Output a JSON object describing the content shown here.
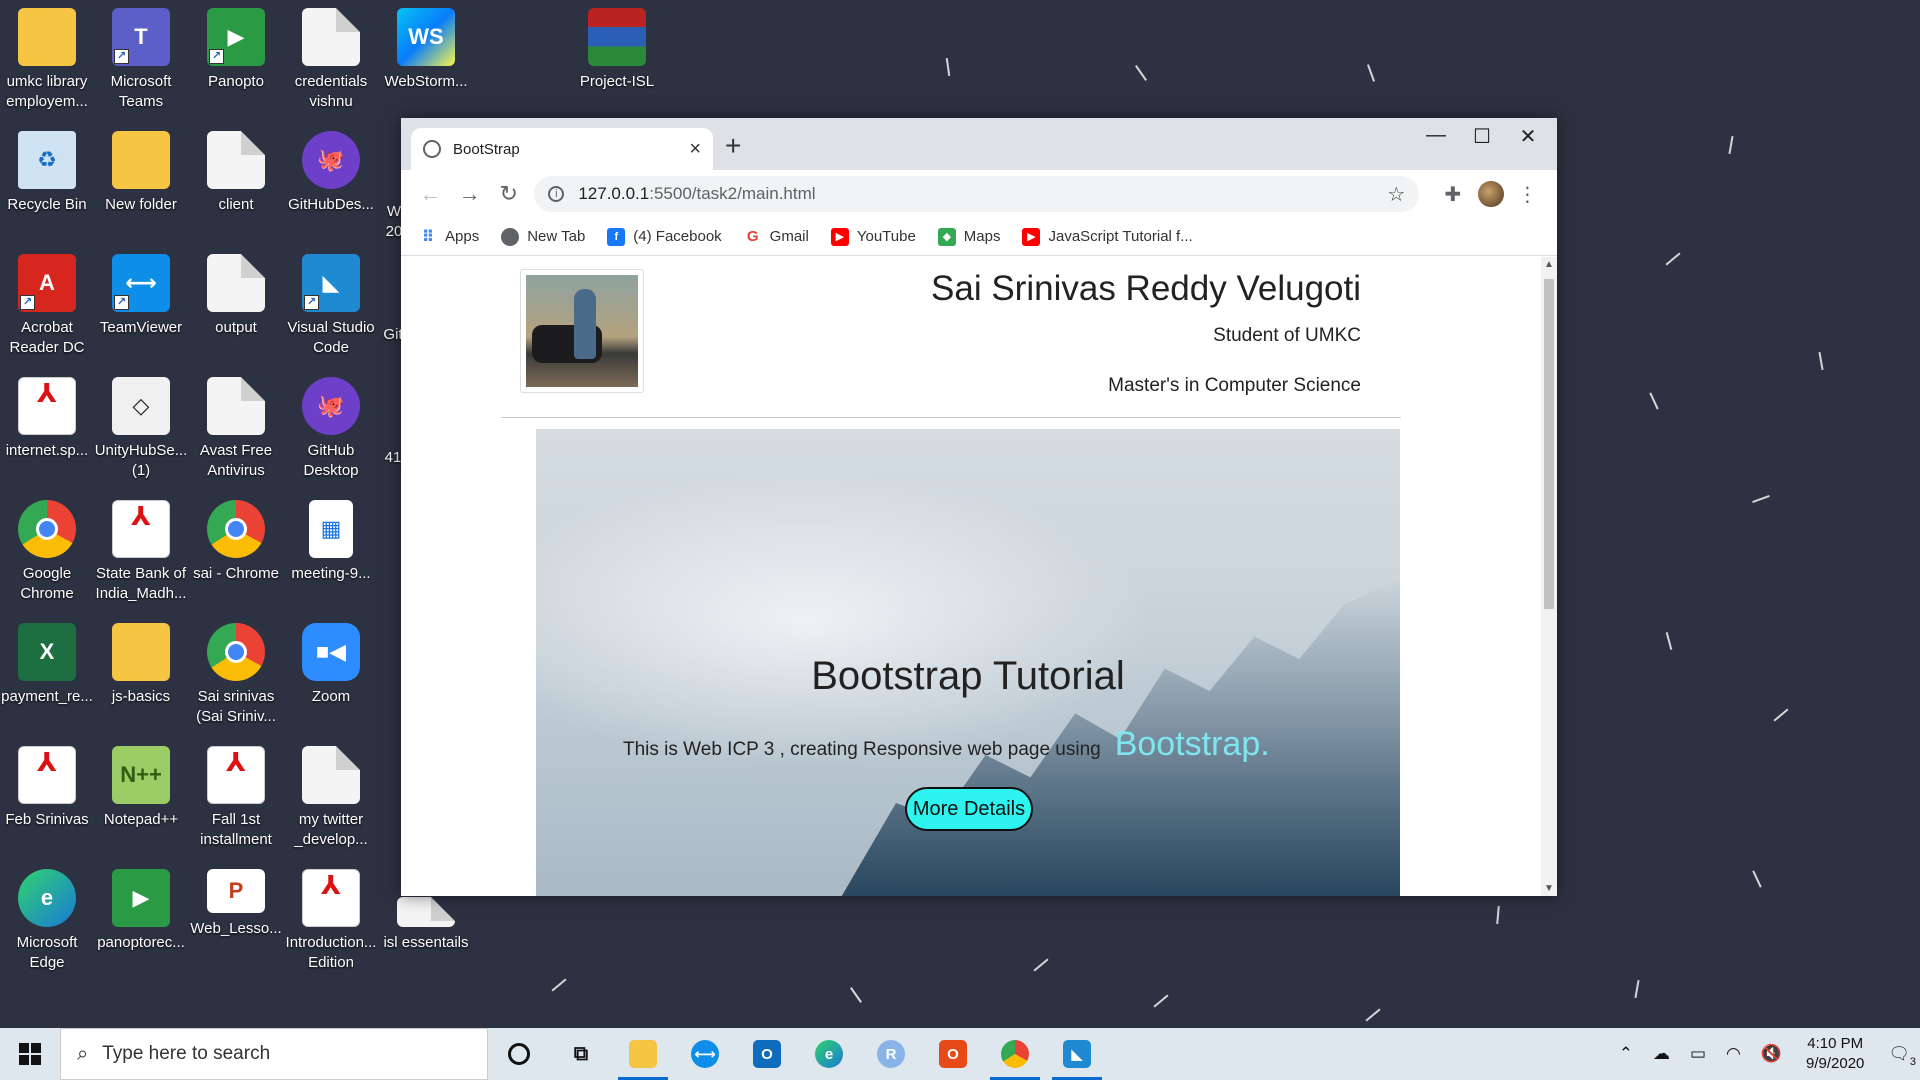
{
  "desktop": {
    "icons": [
      {
        "label": "umkc library employem...",
        "icon": "folder-zip-icon"
      },
      {
        "label": "Microsoft Teams",
        "icon": "teams-icon"
      },
      {
        "label": "Panopto",
        "icon": "panopto-icon"
      },
      {
        "label": "credentials vishnu",
        "icon": "document-icon"
      },
      {
        "label": "WebStorm...",
        "icon": "webstorm-icon"
      },
      {
        "label": "Project-ISL",
        "icon": "winrar-icon"
      },
      {
        "label": "Recycle Bin",
        "icon": "recycle-bin-icon"
      },
      {
        "label": "New folder",
        "icon": "folder-icon"
      },
      {
        "label": "client",
        "icon": "document-icon"
      },
      {
        "label": "GitHubDes...",
        "icon": "github-icon"
      },
      {
        "label": "Acrobat Reader DC",
        "icon": "acrobat-icon"
      },
      {
        "label": "TeamViewer",
        "icon": "teamviewer-icon"
      },
      {
        "label": "output",
        "icon": "document-icon"
      },
      {
        "label": "Visual Studio Code",
        "icon": "vscode-icon"
      },
      {
        "label": "internet.sp...",
        "icon": "pdf-icon"
      },
      {
        "label": "UnityHubSe... (1)",
        "icon": "unity-icon"
      },
      {
        "label": "Avast Free Antivirus",
        "icon": "document-icon"
      },
      {
        "label": "GitHub Desktop",
        "icon": "github-icon"
      },
      {
        "label": "Google Chrome",
        "icon": "chrome-icon"
      },
      {
        "label": "State Bank of India_Madh...",
        "icon": "pdf-icon"
      },
      {
        "label": "sai - Chrome",
        "icon": "chrome-icon"
      },
      {
        "label": "meeting-9...",
        "icon": "calendar-icon"
      },
      {
        "label": "payment_re...",
        "icon": "excel-icon"
      },
      {
        "label": "js-basics",
        "icon": "folder-icon"
      },
      {
        "label": "Sai srinivas (Sai Sriniv...",
        "icon": "chrome-icon"
      },
      {
        "label": "Zoom",
        "icon": "zoom-icon"
      },
      {
        "label": "Feb Srinivas",
        "icon": "pdf-icon"
      },
      {
        "label": "Notepad++",
        "icon": "notepadpp-icon"
      },
      {
        "label": "Fall 1st installment",
        "icon": "pdf-icon"
      },
      {
        "label": "my twitter _develop...",
        "icon": "document-icon"
      },
      {
        "label": "Microsoft Edge",
        "icon": "edge-icon"
      },
      {
        "label": "panoptorec...",
        "icon": "panopto-icon"
      },
      {
        "label": "Web_Lesso...",
        "icon": "powerpoint-icon"
      },
      {
        "label": "Introduction... Edition",
        "icon": "pdf-icon"
      },
      {
        "label": "isl essentails",
        "icon": "document-icon"
      }
    ],
    "partial_labels": [
      "W 20",
      "Git",
      "41"
    ]
  },
  "browser": {
    "tab_title": "BootStrap",
    "url_host": "127.0.0.1",
    "url_path": ":5500/task2/main.html",
    "bookmarks": [
      {
        "label": "Apps",
        "icon": "apps-grid-icon",
        "color": "#4285f4"
      },
      {
        "label": "New Tab",
        "icon": "globe-icon",
        "color": "#5f6368"
      },
      {
        "label": "(4) Facebook",
        "icon": "facebook-icon",
        "color": "#1877f2"
      },
      {
        "label": "Gmail",
        "icon": "google-icon",
        "color": "#ea4335"
      },
      {
        "label": "YouTube",
        "icon": "youtube-icon",
        "color": "#ff0000"
      },
      {
        "label": "Maps",
        "icon": "maps-icon",
        "color": "#34a853"
      },
      {
        "label": "JavaScript Tutorial f...",
        "icon": "youtube-icon",
        "color": "#ff0000"
      }
    ]
  },
  "page": {
    "name": "Sai Srinivas Reddy Velugoti",
    "subtitle1": "Student of UMKC",
    "subtitle2": "Master's in Computer Science",
    "hero_title": "Bootstrap Tutorial",
    "hero_text": "This is Web ICP 3 , creating Responsive web page using",
    "hero_accent": "Bootstrap.",
    "more_button": "More Details"
  },
  "taskbar": {
    "search_placeholder": "Type here to search",
    "time": "4:10 PM",
    "date": "9/9/2020",
    "notification_count": "3",
    "apps": [
      {
        "name": "cortana",
        "icon": "cortana-icon"
      },
      {
        "name": "task-view",
        "icon": "task-view-icon"
      },
      {
        "name": "file-explorer",
        "icon": "folder-icon"
      },
      {
        "name": "teamviewer",
        "icon": "teamviewer-icon"
      },
      {
        "name": "outlook",
        "icon": "outlook-icon"
      },
      {
        "name": "edge",
        "icon": "edge-icon"
      },
      {
        "name": "r",
        "icon": "r-icon"
      },
      {
        "name": "office",
        "icon": "office-icon"
      },
      {
        "name": "chrome",
        "icon": "chrome-icon"
      },
      {
        "name": "vscode",
        "icon": "vscode-icon"
      }
    ]
  }
}
